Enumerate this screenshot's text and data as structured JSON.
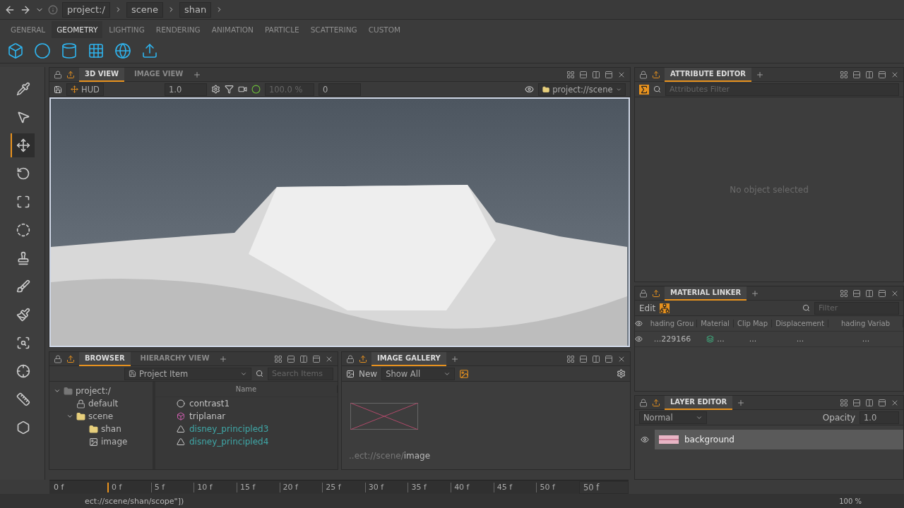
{
  "nav": {
    "path": [
      "project:/",
      "scene",
      "shan"
    ]
  },
  "shelf_tabs": [
    {
      "label": "GENERAL",
      "selected": false
    },
    {
      "label": "GEOMETRY",
      "selected": true
    },
    {
      "label": "LIGHTING",
      "selected": false
    },
    {
      "label": "RENDERING",
      "selected": false
    },
    {
      "label": "ANIMATION",
      "selected": false
    },
    {
      "label": "PARTICLE",
      "selected": false
    },
    {
      "label": "SCATTERING",
      "selected": false
    },
    {
      "label": "CUSTOM",
      "selected": false
    }
  ],
  "tools": [
    {
      "kind": "picker",
      "selected": false
    },
    {
      "kind": "select",
      "selected": false
    },
    {
      "kind": "move",
      "selected": true
    },
    {
      "kind": "rotate",
      "selected": false
    },
    {
      "kind": "scale",
      "selected": false
    },
    {
      "kind": "orbit",
      "selected": false
    },
    {
      "kind": "stamp",
      "selected": false
    },
    {
      "kind": "spray",
      "selected": false
    },
    {
      "kind": "paint",
      "selected": false
    },
    {
      "kind": "frame",
      "selected": false
    },
    {
      "kind": "focus",
      "selected": false
    },
    {
      "kind": "measure",
      "selected": false
    },
    {
      "kind": "swap",
      "selected": false
    }
  ],
  "viewport": {
    "tabs": [
      {
        "label": "3D VIEW",
        "selected": true
      },
      {
        "label": "IMAGE VIEW",
        "selected": false
      }
    ],
    "hud": "HUD",
    "zoom": "1.0",
    "exposure": "100.0 %",
    "frame": "0",
    "context": "project://scene"
  },
  "attribute_editor": {
    "tab": "ATTRIBUTE EDITOR",
    "filter_placeholder": "Attributes Filter",
    "empty_message": "No object selected"
  },
  "material_linker": {
    "tab": "MATERIAL LINKER",
    "edit": "Edit",
    "filter_placeholder": "Filter",
    "columns": [
      "hading Grou",
      "Material",
      "Clip Map",
      "Displacement",
      "hading Variab"
    ],
    "rows": [
      {
        "cells": [
          "...229166",
          "...",
          "...",
          "...",
          "..."
        ]
      }
    ]
  },
  "browser": {
    "tabs": [
      {
        "label": "BROWSER",
        "selected": true
      },
      {
        "label": "HIERARCHY VIEW",
        "selected": false
      }
    ],
    "dropdown": "Project Item",
    "search_placeholder": "Search Items",
    "tree": [
      {
        "label": "project:/",
        "kind": "root",
        "expanded": true,
        "children": [
          {
            "label": "default",
            "kind": "locked"
          },
          {
            "label": "scene",
            "kind": "folder",
            "expanded": true,
            "children": [
              {
                "label": "shan",
                "kind": "folder"
              },
              {
                "label": "image",
                "kind": "image"
              }
            ]
          }
        ]
      }
    ],
    "column": "Name",
    "items": [
      {
        "label": "contrast1",
        "kind": "texture"
      },
      {
        "label": "triplanar",
        "kind": "projection"
      },
      {
        "label": "disney_principled3",
        "kind": "material"
      },
      {
        "label": "disney_principled4",
        "kind": "material"
      }
    ]
  },
  "image_gallery": {
    "tab": "IMAGE GALLERY",
    "new": "New",
    "filter": "Show All",
    "caption_path": "..ect://scene/",
    "caption_name": "image"
  },
  "layer_editor": {
    "tab": "LAYER EDITOR",
    "blend": "Normal",
    "opacity_label": "Opacity",
    "opacity": "1.0",
    "layers": [
      {
        "name": "background",
        "visible": true
      }
    ]
  },
  "timeline": {
    "start": "0 f",
    "ticks": [
      {
        "label": "0 f",
        "current": true
      },
      {
        "label": "5 f",
        "current": false
      },
      {
        "label": "10 f",
        "current": false
      },
      {
        "label": "15 f",
        "current": false
      },
      {
        "label": "20 f",
        "current": false
      },
      {
        "label": "25 f",
        "current": false
      },
      {
        "label": "30 f",
        "current": false
      },
      {
        "label": "35 f",
        "current": false
      },
      {
        "label": "40 f",
        "current": false
      },
      {
        "label": "45 f",
        "current": false
      },
      {
        "label": "50 f",
        "current": false
      }
    ],
    "end": "50 f"
  },
  "status": {
    "text": "ect://scene/shan/scope\"])",
    "zoom": "100 %"
  }
}
